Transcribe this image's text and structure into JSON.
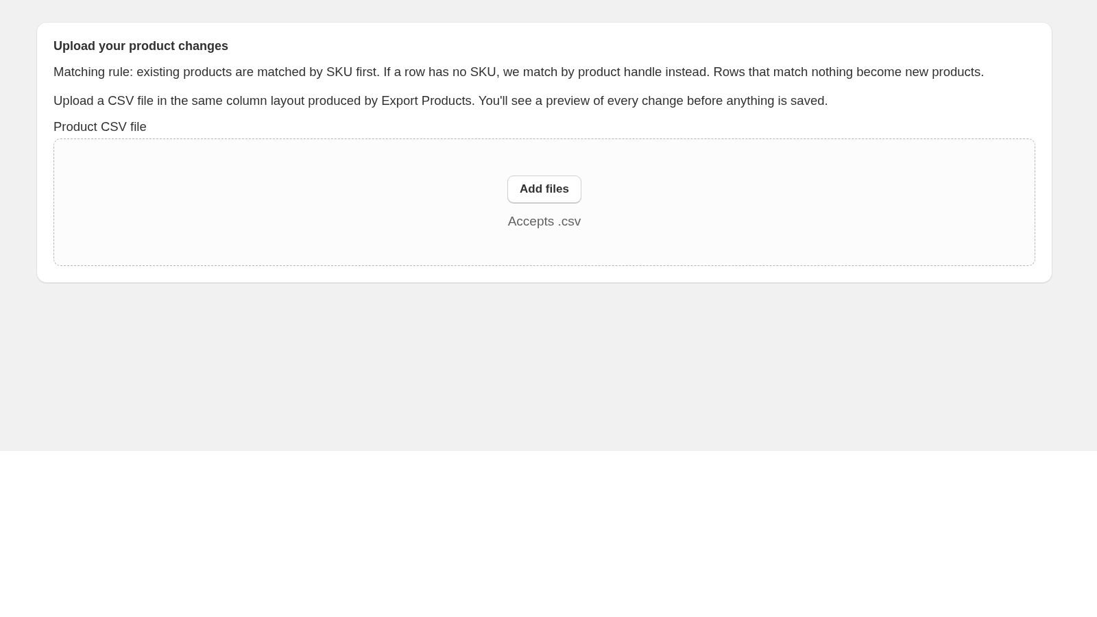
{
  "card": {
    "title": "Upload your product changes",
    "paragraphs": [
      "Matching rule: existing products are matched by SKU first. If a row has no SKU, we match by product handle instead. Rows that match nothing become new products.",
      "Upload a CSV file in the same column layout produced by Export Products. You'll see a preview of every change before anything is saved."
    ],
    "field_label": "Product CSV file",
    "dropzone": {
      "button": "Add files",
      "hint": "Accepts .csv"
    }
  }
}
